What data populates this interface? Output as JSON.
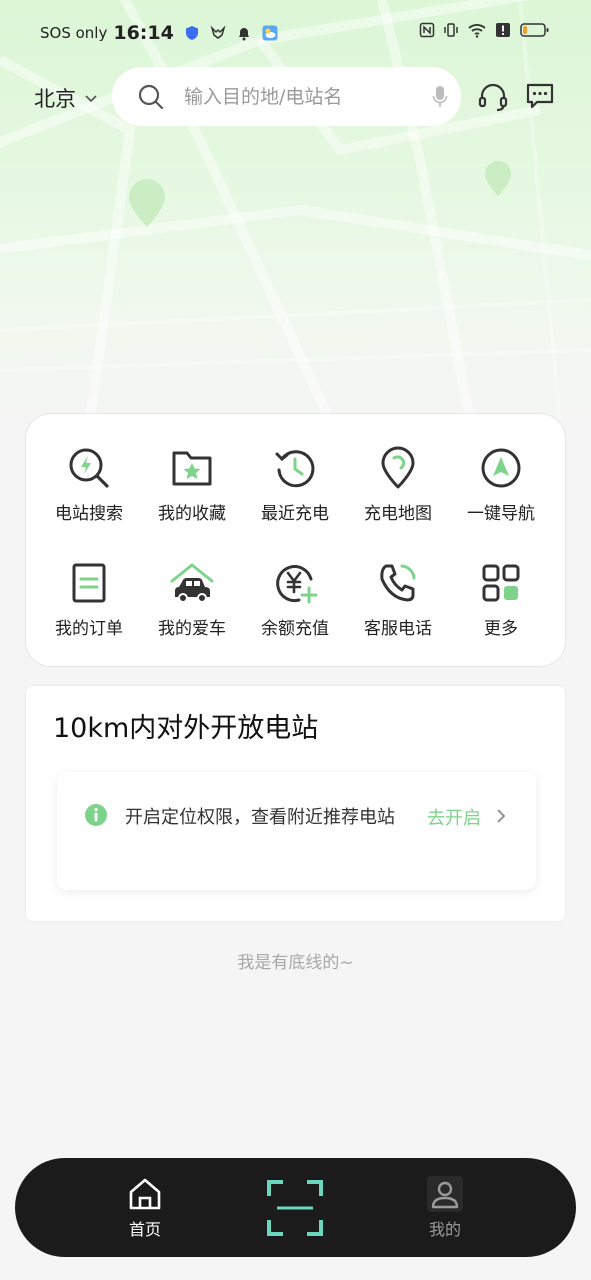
{
  "status_bar": {
    "carrier": "SOS only",
    "time": "16:14",
    "left_icons": [
      "shield-icon",
      "fox-icon",
      "bell-icon",
      "weather-icon"
    ],
    "right_icons": [
      "nfc-icon",
      "vibrate-icon",
      "wifi-icon",
      "alert-icon",
      "battery-icon"
    ],
    "battery_level": 0.2
  },
  "header": {
    "city": "北京",
    "search_placeholder": "输入目的地/电站名"
  },
  "quick_actions": [
    {
      "label": "电站搜索",
      "icon": "station-search-icon"
    },
    {
      "label": "我的收藏",
      "icon": "favorites-icon"
    },
    {
      "label": "最近充电",
      "icon": "recent-charge-icon"
    },
    {
      "label": "充电地图",
      "icon": "charge-map-icon"
    },
    {
      "label": "一键导航",
      "icon": "navigation-icon"
    },
    {
      "label": "我的订单",
      "icon": "orders-icon"
    },
    {
      "label": "我的爱车",
      "icon": "my-car-icon"
    },
    {
      "label": "余额充值",
      "icon": "balance-topup-icon"
    },
    {
      "label": "客服电话",
      "icon": "service-phone-icon"
    },
    {
      "label": "更多",
      "icon": "more-icon"
    }
  ],
  "nearby": {
    "title": "10km内对外开放电站",
    "permission_text": "开启定位权限，查看附近推荐电站",
    "permission_action": "去开启"
  },
  "footer_note": "我是有底线的~",
  "bottom_nav": {
    "home_label": "首页",
    "me_label": "我的",
    "active": "home"
  },
  "colors": {
    "accent_green": "#7ed38a",
    "scan_teal": "#69d6c0",
    "nav_bg": "#1b1b1b",
    "icon_dark": "#333333"
  }
}
